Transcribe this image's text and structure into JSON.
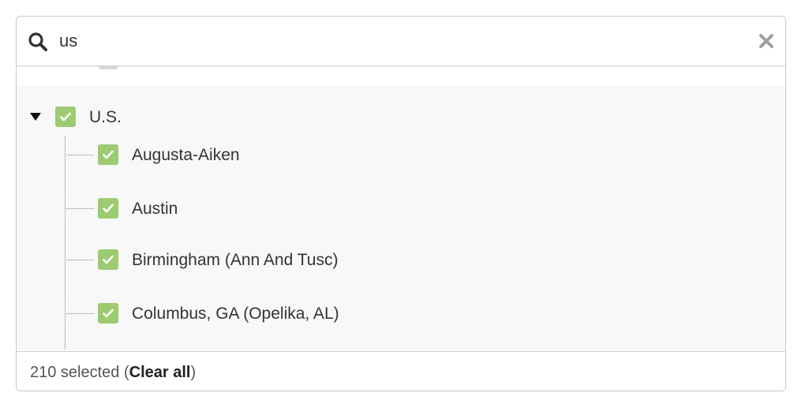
{
  "search": {
    "value": "us",
    "icon": "search-icon",
    "clear_icon": "close-icon"
  },
  "tree": {
    "group": {
      "label": "U.S.",
      "expanded": true,
      "checked": true
    },
    "children": [
      {
        "label": "Augusta-Aiken",
        "checked": true
      },
      {
        "label": "Austin",
        "checked": true
      },
      {
        "label": "Birmingham (Ann And Tusc)",
        "checked": true
      },
      {
        "label": "Columbus, GA (Opelika, AL)",
        "checked": true
      }
    ]
  },
  "footer": {
    "count_text": "210 selected",
    "open_paren": " (",
    "clear_all_label": "Clear all",
    "close_paren": ")"
  },
  "colors": {
    "checkbox_checked": "#9ccb72",
    "group_background": "#f8f8f8",
    "border": "#c7c7c7"
  }
}
